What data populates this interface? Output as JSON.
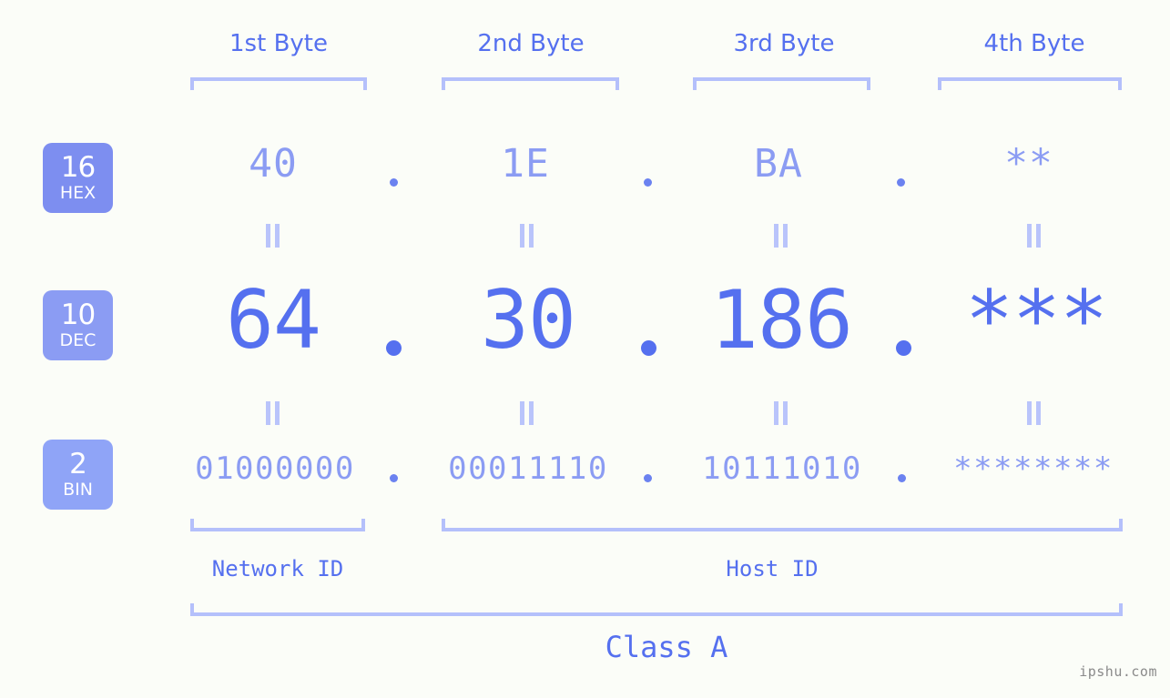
{
  "meta": {
    "background_color": "#fbfdf8",
    "accent_color": "#5570ef",
    "muted_accent_color": "#8b9cf3",
    "light_accent_color": "#b4c0fb",
    "badge_color": "#7d8ef0"
  },
  "byte_headers": [
    {
      "label": "1st Byte"
    },
    {
      "label": "2nd Byte"
    },
    {
      "label": "3rd Byte"
    },
    {
      "label": "4th Byte"
    }
  ],
  "bases": [
    {
      "number": "16",
      "name": "HEX"
    },
    {
      "number": "10",
      "name": "DEC"
    },
    {
      "number": "2",
      "name": "BIN"
    }
  ],
  "rows": {
    "hex": {
      "base": "16",
      "base_name": "HEX",
      "values": [
        "40",
        "1E",
        "BA",
        "**"
      ]
    },
    "dec": {
      "base": "10",
      "base_name": "DEC",
      "values": [
        "64",
        "30",
        "186",
        "***"
      ]
    },
    "bin": {
      "base": "2",
      "base_name": "BIN",
      "values": [
        "01000000",
        "00011110",
        "10111010",
        "********"
      ]
    }
  },
  "separators": {
    "dot": "."
  },
  "equals_marker": "=",
  "sections": [
    {
      "label": "Network ID"
    },
    {
      "label": "Host ID"
    }
  ],
  "class": {
    "label": "Class A"
  },
  "watermark": {
    "text": "ipshu.com"
  }
}
